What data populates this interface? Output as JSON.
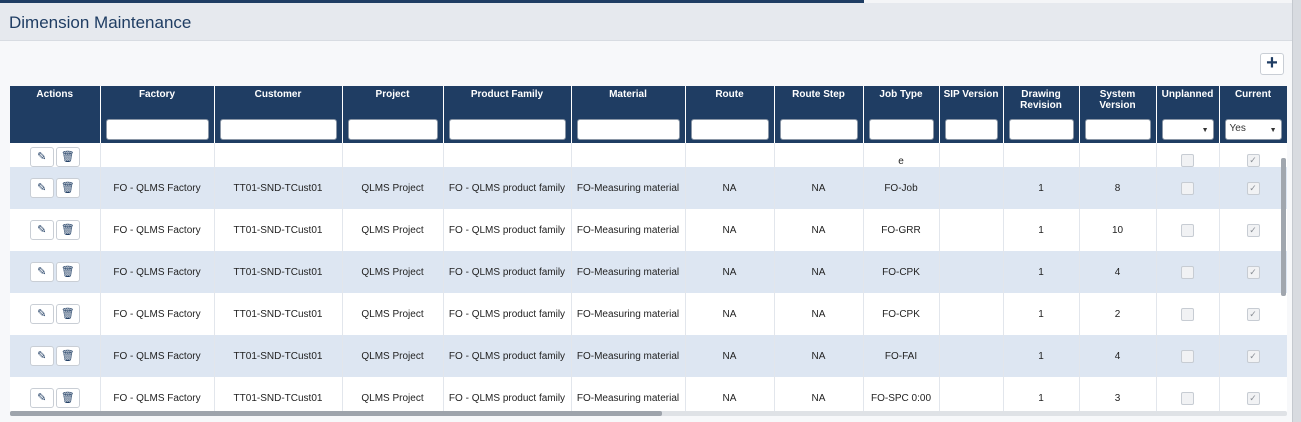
{
  "header": {
    "title": "Dimension Maintenance"
  },
  "toolbar": {
    "add_label": "+"
  },
  "columns": [
    {
      "label": "Actions",
      "filter": "none"
    },
    {
      "label": "Factory",
      "filter": "text",
      "value": ""
    },
    {
      "label": "Customer",
      "filter": "text",
      "value": ""
    },
    {
      "label": "Project",
      "filter": "text",
      "value": ""
    },
    {
      "label": "Product Family",
      "filter": "text",
      "value": ""
    },
    {
      "label": "Material",
      "filter": "text",
      "value": ""
    },
    {
      "label": "Route",
      "filter": "text",
      "value": ""
    },
    {
      "label": "Route Step",
      "filter": "text",
      "value": ""
    },
    {
      "label": "Job Type",
      "filter": "text",
      "value": ""
    },
    {
      "label": "SIP Version",
      "filter": "text",
      "value": ""
    },
    {
      "label": "Drawing Revision",
      "filter": "text",
      "value": ""
    },
    {
      "label": "System Version",
      "filter": "text",
      "value": ""
    },
    {
      "label": "Unplanned",
      "filter": "select",
      "value": ""
    },
    {
      "label": "Current",
      "filter": "select",
      "value": "Yes"
    }
  ],
  "partial_row": {
    "job_type": "e",
    "unplanned": false,
    "current": true
  },
  "rows": [
    {
      "factory": "FO - QLMS Factory",
      "customer": "TT01-SND-TCust01",
      "project": "QLMS Project",
      "product_family": "FO - QLMS product family",
      "material": "FO-Measuring material",
      "route": "NA",
      "route_step": "NA",
      "job_type": "FO-Job",
      "sip_version": "",
      "drawing_revision": "1",
      "system_version": "8",
      "unplanned": false,
      "current": true
    },
    {
      "factory": "FO - QLMS Factory",
      "customer": "TT01-SND-TCust01",
      "project": "QLMS Project",
      "product_family": "FO - QLMS product family",
      "material": "FO-Measuring material",
      "route": "NA",
      "route_step": "NA",
      "job_type": "FO-GRR",
      "sip_version": "",
      "drawing_revision": "1",
      "system_version": "10",
      "unplanned": false,
      "current": true
    },
    {
      "factory": "FO - QLMS Factory",
      "customer": "TT01-SND-TCust01",
      "project": "QLMS Project",
      "product_family": "FO - QLMS product family",
      "material": "FO-Measuring material",
      "route": "NA",
      "route_step": "NA",
      "job_type": "FO-CPK",
      "sip_version": "",
      "drawing_revision": "1",
      "system_version": "4",
      "unplanned": false,
      "current": true
    },
    {
      "factory": "FO - QLMS Factory",
      "customer": "TT01-SND-TCust01",
      "project": "QLMS Project",
      "product_family": "FO - QLMS product family",
      "material": "FO-Measuring material",
      "route": "NA",
      "route_step": "NA",
      "job_type": "FO-CPK",
      "sip_version": "",
      "drawing_revision": "1",
      "system_version": "2",
      "unplanned": false,
      "current": true
    },
    {
      "factory": "FO - QLMS Factory",
      "customer": "TT01-SND-TCust01",
      "project": "QLMS Project",
      "product_family": "FO - QLMS product family",
      "material": "FO-Measuring material",
      "route": "NA",
      "route_step": "NA",
      "job_type": "FO-FAI",
      "sip_version": "",
      "drawing_revision": "1",
      "system_version": "4",
      "unplanned": false,
      "current": true
    },
    {
      "factory": "FO - QLMS Factory",
      "customer": "TT01-SND-TCust01",
      "project": "QLMS Project",
      "product_family": "FO - QLMS product family",
      "material": "FO-Measuring material",
      "route": "NA",
      "route_step": "NA",
      "job_type": "FO-SPC 0:00",
      "sip_version": "",
      "drawing_revision": "1",
      "system_version": "3",
      "unplanned": false,
      "current": true
    }
  ],
  "icons": {
    "edit": "pencil-icon",
    "delete": "trash-icon",
    "add": "plus-icon"
  },
  "colors": {
    "header_bg": "#1f3d63",
    "alt_row": "#dde6f2",
    "title": "#1f3d63"
  }
}
